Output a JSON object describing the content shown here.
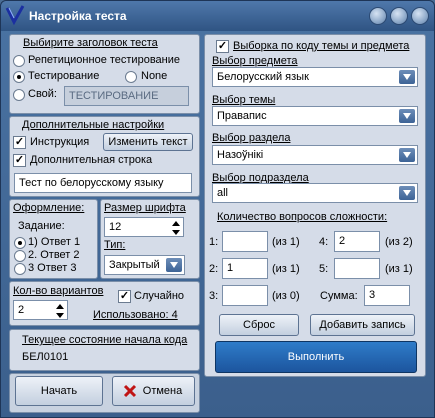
{
  "window": {
    "title": "Настройка теста"
  },
  "header_group": {
    "label": "Выбирите заголовок теста",
    "options": [
      "Репетиционное тестирование",
      "Тестирование",
      "None",
      "Свой:"
    ],
    "selected": "Тестирование",
    "custom_value": "ТЕСТИРОВАНИЕ"
  },
  "extra": {
    "label": "Дополнительные настройки",
    "instruction_label": "Инструкция",
    "instruction_checked": true,
    "change_text_button": "Изменить текст",
    "extra_line_label": "Дополнительная строка",
    "extra_line_checked": true,
    "extra_line_value": "Тест по белорусскому языку"
  },
  "design": {
    "label": "Оформление:",
    "task_label": "Задание:",
    "options": [
      "1) Ответ 1",
      "2. Ответ 2",
      "3  Ответ 3"
    ],
    "selected": "1) Ответ 1"
  },
  "font": {
    "size_label": "Размер шрифта",
    "size_value": "12",
    "type_label": "Тип:",
    "type_value": "Закрытый"
  },
  "variants": {
    "label": "Кол-во вариантов",
    "value": "2",
    "random_label": "Случайно",
    "random_checked": true,
    "used_label": "Использовано: 4"
  },
  "code_state": {
    "label": "Текущее состояние начала кода",
    "value": "БЕЛ0101"
  },
  "bottom_buttons": {
    "start": "Начать",
    "cancel": "Отмена"
  },
  "right": {
    "by_code_label": "Выборка по коду темы и предмета",
    "by_code_checked": true,
    "subject_label": "Выбор предмета",
    "subject_value": "Белорусский язык",
    "topic_label": "Выбор темы",
    "topic_value": "Правапис",
    "section_label": "Выбор раздела",
    "section_value": "Назоўнікі",
    "subsection_label": "Выбор подраздела",
    "subsection_value": "all",
    "difficulty_label": "Количество вопросов сложности:",
    "difficulty": [
      {
        "n": "1:",
        "value": "",
        "of": "(из 1)"
      },
      {
        "n": "2:",
        "value": "1",
        "of": "(из 1)"
      },
      {
        "n": "3:",
        "value": "",
        "of": "(из 0)"
      },
      {
        "n": "4:",
        "value": "2",
        "of": "(из 2)"
      },
      {
        "n": "5:",
        "value": "",
        "of": "(из 1)"
      }
    ],
    "sum_label": "Сумма:",
    "sum_value": "3",
    "reset_button": "Сброс",
    "add_button": "Добавить запись",
    "run_button": "Выполнить"
  }
}
